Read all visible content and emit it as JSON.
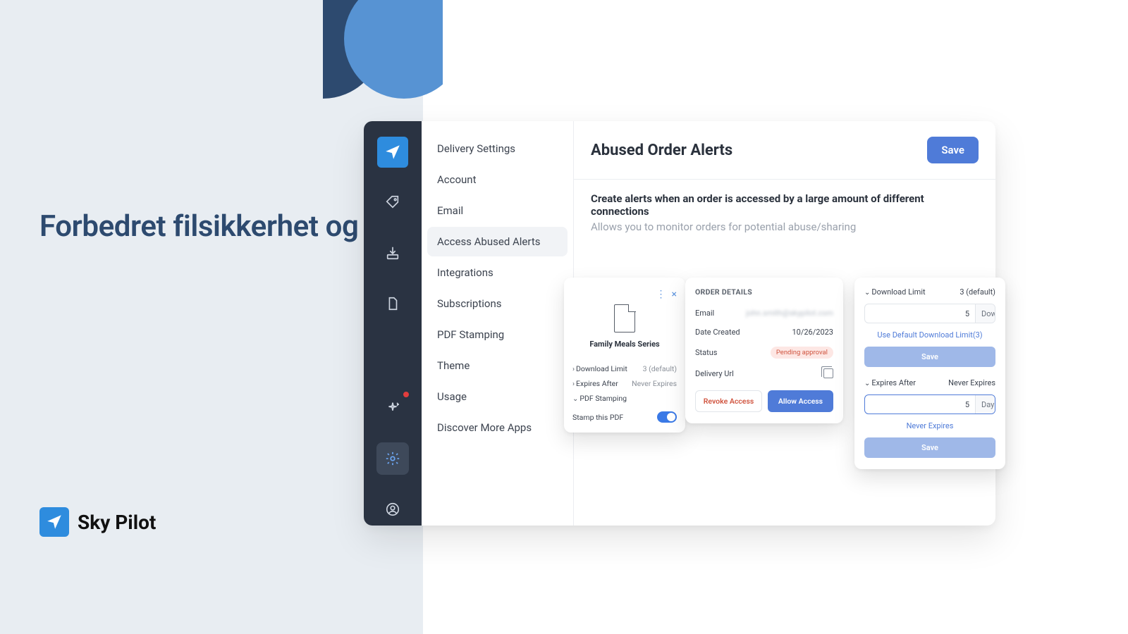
{
  "hero": {
    "text": "Forbedret filsikkerhet og risikostyring"
  },
  "brand": {
    "name": "Sky Pilot"
  },
  "rail": {
    "icons": [
      "tag",
      "download",
      "file",
      "sparkle",
      "settings",
      "user"
    ]
  },
  "subnav": {
    "items": [
      "Delivery Settings",
      "Account",
      "Email",
      "Access Abused Alerts",
      "Integrations",
      "Subscriptions",
      "PDF Stamping",
      "Theme",
      "Usage",
      "Discover More Apps"
    ],
    "active": 3
  },
  "main": {
    "title": "Abused Order Alerts",
    "save": "Save",
    "desc_bold": "Create alerts when an order is accessed by a large amount of different connections",
    "desc_sub": "Allows you to monitor orders for potential abuse/sharing"
  },
  "product": {
    "name": "Family Meals Series",
    "rows": [
      {
        "chev": "›",
        "label": "Download Limit",
        "value": "3 (default)"
      },
      {
        "chev": "›",
        "label": "Expires After",
        "value": "Never Expires"
      },
      {
        "chev": "⌄",
        "label": "PDF Stamping",
        "value": ""
      }
    ],
    "stamp_label": "Stamp this PDF"
  },
  "order": {
    "title": "ORDER DETAILS",
    "email_label": "Email",
    "email_val": "john.smith@skypilot.com",
    "date_label": "Date Created",
    "date_val": "10/26/2023",
    "status_label": "Status",
    "status_val": "Pending approval",
    "url_label": "Delivery Url",
    "revoke": "Revoke Access",
    "allow": "Allow Access"
  },
  "limit": {
    "dl_label": "Download Limit",
    "dl_val": "3 (default)",
    "dl_input": "5",
    "dl_suffix": "Downloads",
    "default_link": "Use Default Download Limit(3)",
    "save1": "Save",
    "exp_label": "Expires After",
    "exp_val": "Never Expires",
    "exp_input": "5",
    "exp_suffix": "Days",
    "never_link": "Never Expires",
    "save2": "Save"
  }
}
